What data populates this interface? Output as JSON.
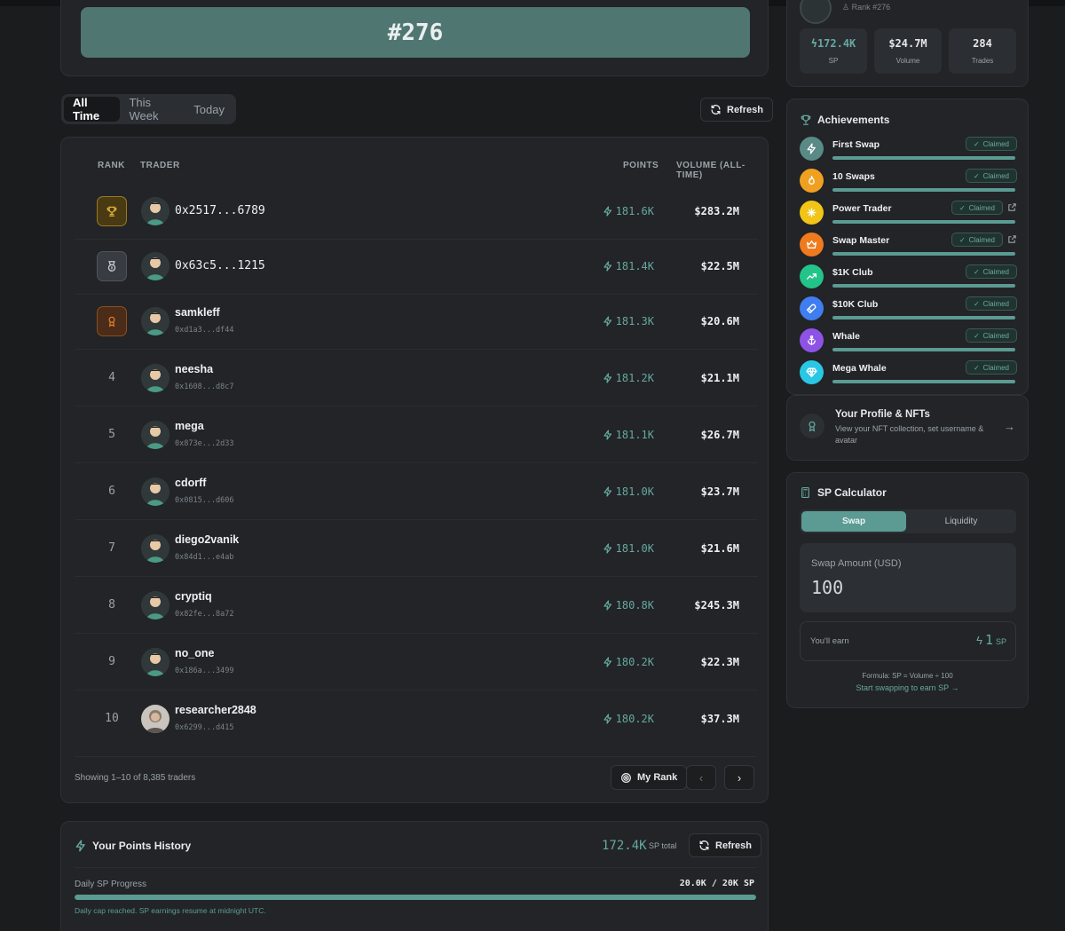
{
  "rank_card": {
    "rank": "#276"
  },
  "tabs": [
    {
      "label": "All Time",
      "active": true
    },
    {
      "label": "This Week",
      "active": false
    },
    {
      "label": "Today",
      "active": false
    }
  ],
  "refresh_label": "Refresh",
  "leaderboard": {
    "headers": {
      "rank": "RANK",
      "trader": "TRADER",
      "points": "POINTS",
      "volume": "VOLUME (ALL-TIME)"
    },
    "rows": [
      {
        "rank": "1",
        "name": "0x2517...6789",
        "address": "",
        "points": "181.6K",
        "volume": "$283.2M"
      },
      {
        "rank": "2",
        "name": "0x63c5...1215",
        "address": "",
        "points": "181.4K",
        "volume": "$22.5M"
      },
      {
        "rank": "3",
        "name": "samkleff",
        "address": "0xd1a3...df44",
        "points": "181.3K",
        "volume": "$20.6M"
      },
      {
        "rank": "4",
        "name": "neesha",
        "address": "0x1608...d8c7",
        "points": "181.2K",
        "volume": "$21.1M"
      },
      {
        "rank": "5",
        "name": "mega",
        "address": "0x873e...2d33",
        "points": "181.1K",
        "volume": "$26.7M"
      },
      {
        "rank": "6",
        "name": "cdorff",
        "address": "0x0815...d606",
        "points": "181.0K",
        "volume": "$23.7M"
      },
      {
        "rank": "7",
        "name": "diego2vanik",
        "address": "0x84d1...e4ab",
        "points": "181.0K",
        "volume": "$21.6M"
      },
      {
        "rank": "8",
        "name": "cryptiq",
        "address": "0x82fe...8a72",
        "points": "180.8K",
        "volume": "$245.3M"
      },
      {
        "rank": "9",
        "name": "no_one",
        "address": "0x186a...3499",
        "points": "180.2K",
        "volume": "$22.3M"
      },
      {
        "rank": "10",
        "name": "researcher2848",
        "address": "0x6299...d415",
        "points": "180.2K",
        "volume": "$37.3M"
      }
    ],
    "showing": "Showing 1–10 of 8,385 traders",
    "my_rank_label": "My Rank"
  },
  "history": {
    "title": "Your Points History",
    "total_value": "172.4K",
    "total_suffix": "SP total",
    "refresh_label": "Refresh",
    "progress_label": "Daily SP Progress",
    "progress_value": "20.0K / 20K SP",
    "progress_fraction": 1.0,
    "cap_note": "Daily cap reached. SP earnings resume at midnight UTC."
  },
  "profile_stats": {
    "rank_label": "Rank #276",
    "stats": [
      {
        "value": "172.4K",
        "label": "SP"
      },
      {
        "value": "$24.7M",
        "label": "Volume"
      },
      {
        "value": "284",
        "label": "Trades"
      }
    ]
  },
  "achievements": {
    "title": "Achievements",
    "claimed_label": "Claimed",
    "items": [
      {
        "name": "First Swap",
        "color": "#5a8a86",
        "icon": "lightning-icon",
        "external": false
      },
      {
        "name": "10 Swaps",
        "color": "#f0a020",
        "icon": "flame-icon",
        "external": false
      },
      {
        "name": "Power Trader",
        "color": "#f2c417",
        "icon": "sparkle-icon",
        "external": true
      },
      {
        "name": "Swap Master",
        "color": "#f07a1e",
        "icon": "crown-icon",
        "external": true
      },
      {
        "name": "$1K Club",
        "color": "#22c48a",
        "icon": "trend-up-icon",
        "external": false
      },
      {
        "name": "$10K Club",
        "color": "#3f7df0",
        "icon": "rocket-icon",
        "external": false
      },
      {
        "name": "Whale",
        "color": "#8e53e6",
        "icon": "anchor-icon",
        "external": false
      },
      {
        "name": "Mega Whale",
        "color": "#2ac6e6",
        "icon": "diamond-icon",
        "external": false
      }
    ]
  },
  "profile_card": {
    "title": "Your Profile & NFTs",
    "subtitle": "View your NFT collection, set username & avatar"
  },
  "calculator": {
    "title": "SP Calculator",
    "tabs": [
      "Swap",
      "Liquidity"
    ],
    "input_label": "Swap Amount (USD)",
    "input_value": "100",
    "earn_label": "You'll earn",
    "earn_value": "1",
    "earn_unit": "SP",
    "formula": "Formula: SP = Volume ÷ 100",
    "cta": "Start swapping to earn SP"
  }
}
